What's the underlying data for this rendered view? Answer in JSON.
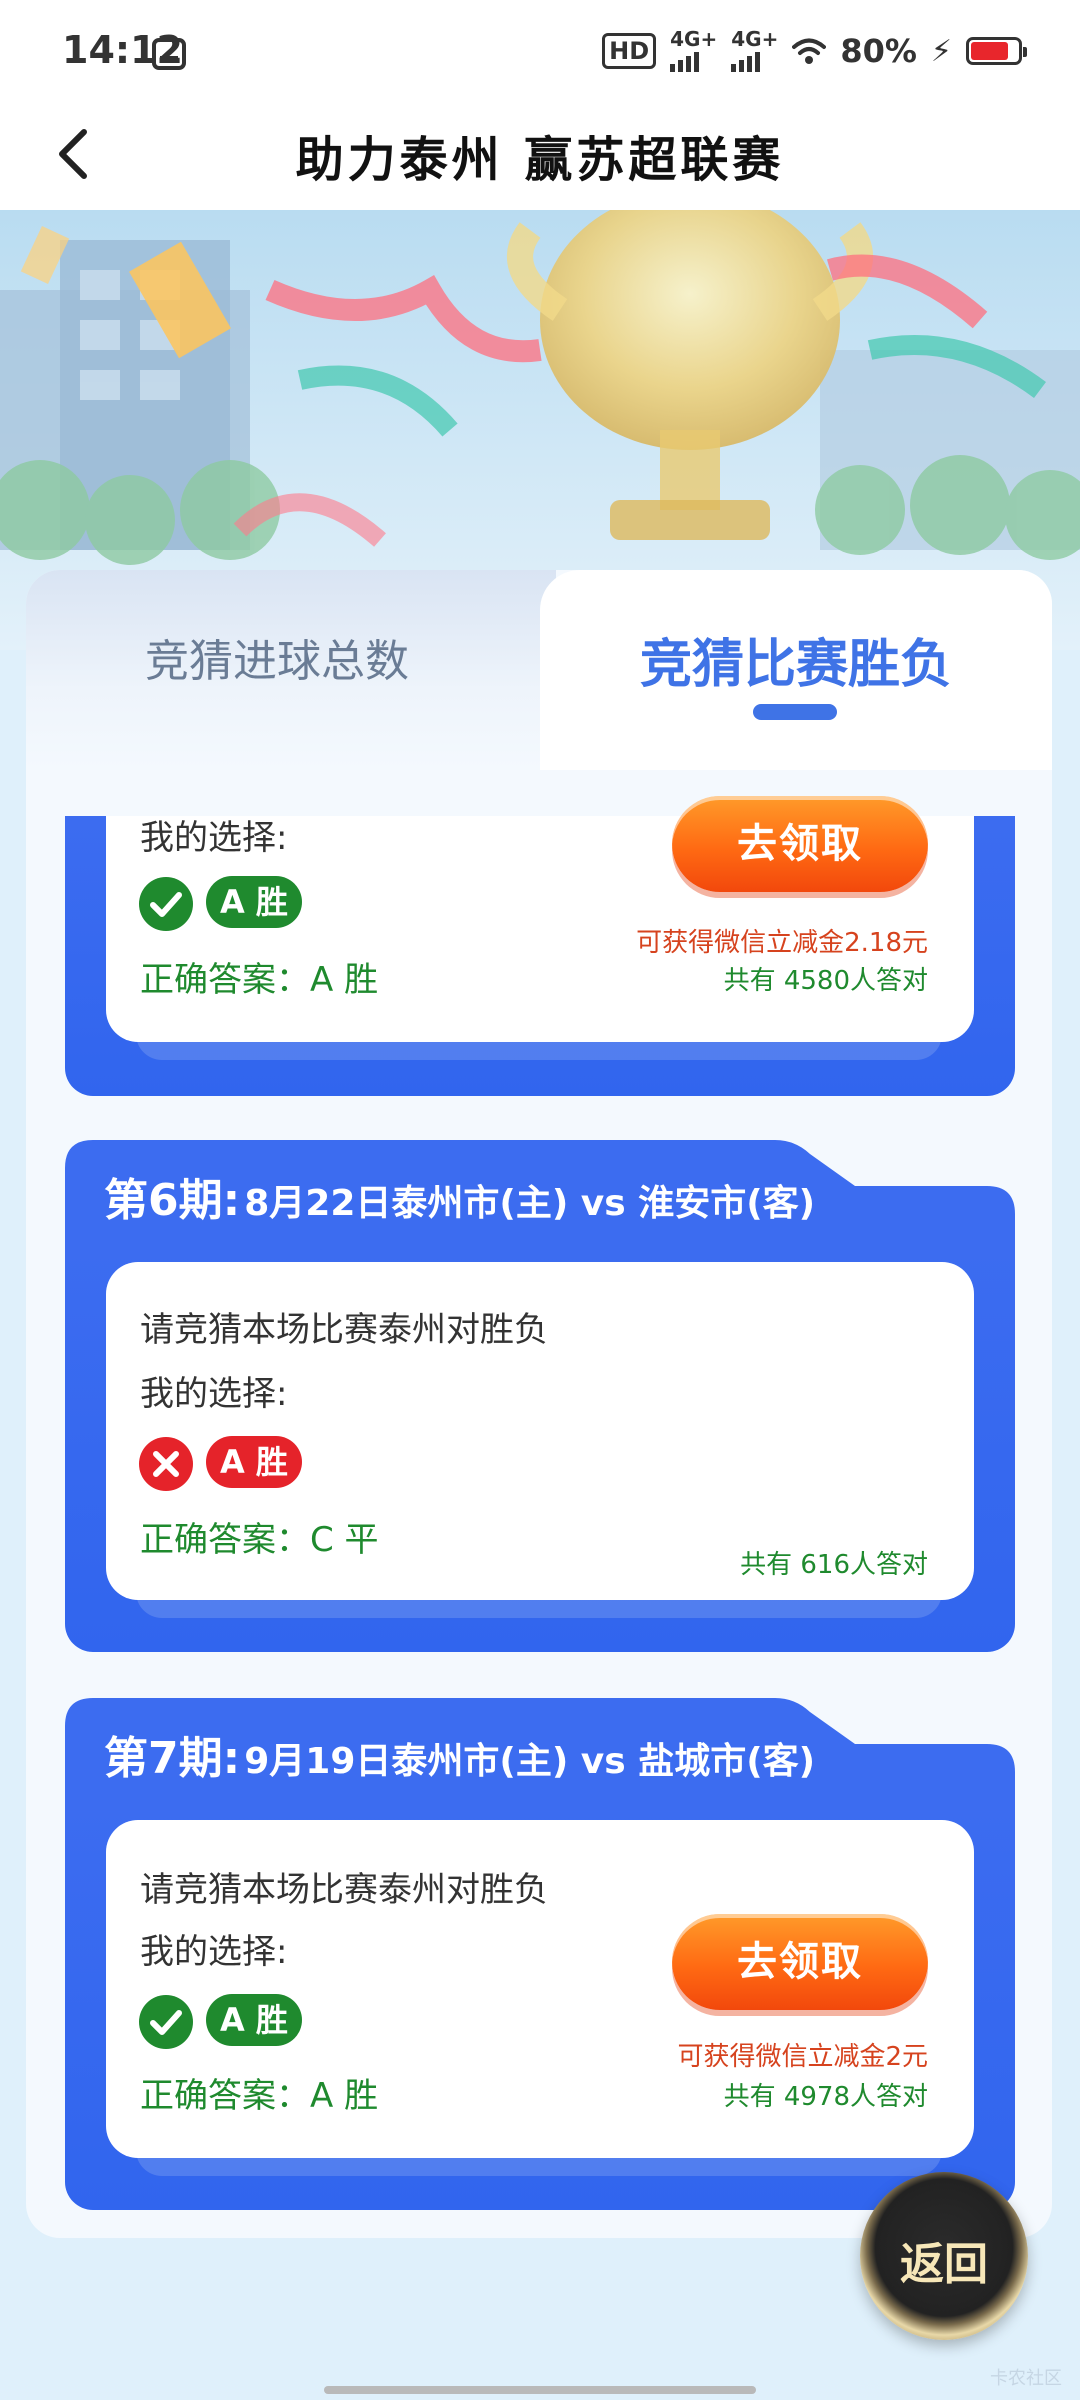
{
  "status_bar": {
    "time": "14:12",
    "hd": "HD",
    "signal1": "4G+",
    "signal2": "4G+",
    "battery": "80%"
  },
  "header": {
    "title": "助力泰州  赢苏超联赛"
  },
  "tabs": [
    {
      "label": "竞猜进球总数",
      "active": false
    },
    {
      "label": "竞猜比赛胜负",
      "active": true
    }
  ],
  "cards": [
    {
      "choice_label": "我的选择:",
      "choice": "A 胜",
      "correct": true,
      "answer": "正确答案：A 胜",
      "button": "去领取",
      "reward": "可获得微信立减金2.18元",
      "count": "共有 4580人答对"
    },
    {
      "period": "第6期:",
      "match": "8月22日泰州市(主) vs 淮安市(客)",
      "question": "请竞猜本场比赛泰州对胜负",
      "choice_label": "我的选择:",
      "choice": "A 胜",
      "correct": false,
      "answer": "正确答案：C 平",
      "count": "共有 616人答对"
    },
    {
      "period": "第7期:",
      "match": "9月19日泰州市(主) vs 盐城市(客)",
      "question": "请竞猜本场比赛泰州对胜负",
      "choice_label": "我的选择:",
      "choice": "A 胜",
      "correct": true,
      "answer": "正确答案：A 胜",
      "button": "去领取",
      "reward": "可获得微信立减金2元",
      "count": "共有 4978人答对"
    }
  ],
  "return_button": "返回",
  "watermark": "卡农社区",
  "colors": {
    "primary_blue": "#3f73e6",
    "card_blue": "#3165ee",
    "success_green": "#1f8a2e",
    "error_red": "#e5232a",
    "button_orange": "#ff6a13",
    "reward_red": "#d6431e"
  }
}
